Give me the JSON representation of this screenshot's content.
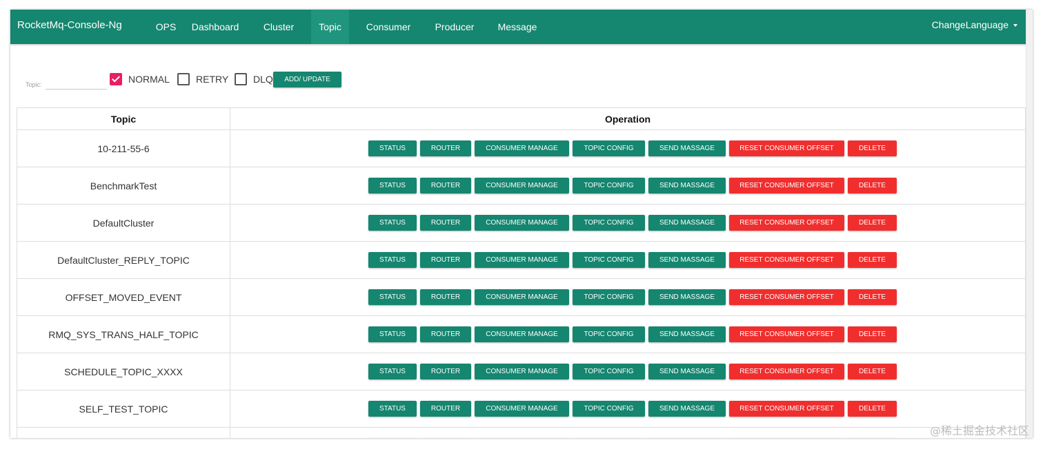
{
  "navbar": {
    "brand": "RocketMq-Console-Ng",
    "items": [
      {
        "label": "OPS"
      },
      {
        "label": "Dashboard"
      },
      {
        "label": "Cluster"
      },
      {
        "label": "Topic",
        "active": true
      },
      {
        "label": "Consumer"
      },
      {
        "label": "Producer"
      },
      {
        "label": "Message"
      }
    ],
    "language": "ChangeLanguage"
  },
  "filter": {
    "topic_label": "Topic:",
    "topic_value": "",
    "checkboxes": [
      {
        "label": "NORMAL",
        "checked": true
      },
      {
        "label": "RETRY",
        "checked": false
      },
      {
        "label": "DLQ",
        "checked": false
      }
    ],
    "add_button": "ADD/ UPDATE"
  },
  "table": {
    "headers": {
      "topic": "Topic",
      "operation": "Operation"
    },
    "actions": {
      "status": "STATUS",
      "router": "ROUTER",
      "consumer_manage": "CONSUMER MANAGE",
      "topic_config": "TOPIC CONFIG",
      "send_message": "SEND MASSAGE",
      "reset_offset": "RESET CONSUMER OFFSET",
      "delete": "DELETE"
    },
    "rows": [
      {
        "topic": "10-211-55-6"
      },
      {
        "topic": "BenchmarkTest"
      },
      {
        "topic": "DefaultCluster"
      },
      {
        "topic": "DefaultCluster_REPLY_TOPIC"
      },
      {
        "topic": "OFFSET_MOVED_EVENT"
      },
      {
        "topic": "RMQ_SYS_TRANS_HALF_TOPIC"
      },
      {
        "topic": "SCHEDULE_TOPIC_XXXX"
      },
      {
        "topic": "SELF_TEST_TOPIC"
      },
      {
        "topic": ""
      }
    ]
  },
  "watermark": "@稀土掘金技术社区",
  "colors": {
    "primary": "#15866f",
    "active_nav": "#1f957d",
    "danger": "#f12e2e",
    "checkbox_checked": "#e91e63"
  }
}
